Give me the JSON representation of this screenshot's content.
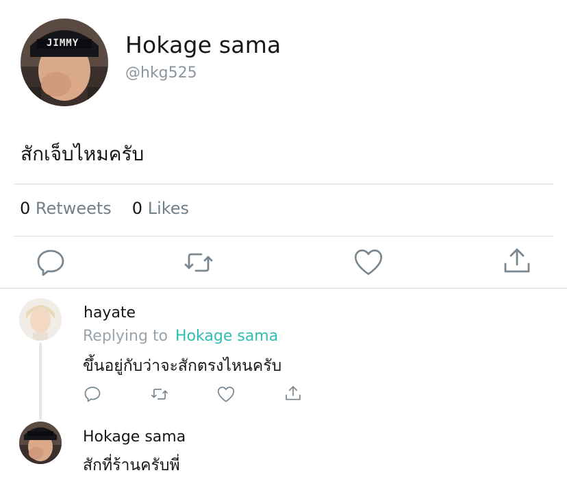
{
  "tweet": {
    "author_name": "Hokage sama",
    "author_handle": "@hkg525",
    "text": "สักเจ็บไหมครับ",
    "avatar_cap_text": "JIMMY",
    "stats": {
      "retweets_count": "0",
      "retweets_label": "Retweets",
      "likes_count": "0",
      "likes_label": "Likes"
    },
    "actions": [
      "reply-icon",
      "retweet-icon",
      "like-icon",
      "share-icon"
    ]
  },
  "replies": [
    {
      "author_name": "hayate",
      "replying_to_label": "Replying to",
      "replying_to_name": "Hokage sama",
      "text": "ขึ้นอยู่กับว่าจะสักตรงไหนครับ",
      "actions": [
        "reply-icon",
        "retweet-icon",
        "like-icon",
        "share-icon"
      ]
    },
    {
      "author_name": "Hokage sama",
      "text": "สักที่ร้านครับพี่"
    }
  ],
  "colors": {
    "text": "#14171a",
    "muted": "#8b959e",
    "accent_link": "#2fbdb4",
    "divider": "#d8dde1",
    "icon": "#7b8790"
  }
}
